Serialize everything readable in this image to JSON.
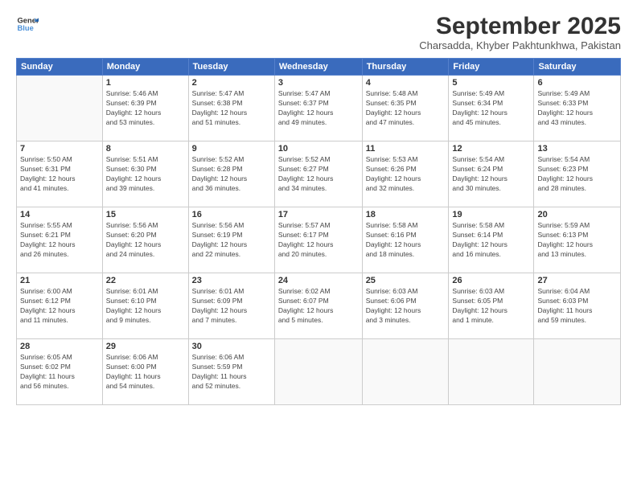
{
  "header": {
    "logo_line1": "General",
    "logo_line2": "Blue",
    "month": "September 2025",
    "location": "Charsadda, Khyber Pakhtunkhwa, Pakistan"
  },
  "weekdays": [
    "Sunday",
    "Monday",
    "Tuesday",
    "Wednesday",
    "Thursday",
    "Friday",
    "Saturday"
  ],
  "weeks": [
    [
      {
        "day": "",
        "detail": ""
      },
      {
        "day": "1",
        "detail": "Sunrise: 5:46 AM\nSunset: 6:39 PM\nDaylight: 12 hours\nand 53 minutes."
      },
      {
        "day": "2",
        "detail": "Sunrise: 5:47 AM\nSunset: 6:38 PM\nDaylight: 12 hours\nand 51 minutes."
      },
      {
        "day": "3",
        "detail": "Sunrise: 5:47 AM\nSunset: 6:37 PM\nDaylight: 12 hours\nand 49 minutes."
      },
      {
        "day": "4",
        "detail": "Sunrise: 5:48 AM\nSunset: 6:35 PM\nDaylight: 12 hours\nand 47 minutes."
      },
      {
        "day": "5",
        "detail": "Sunrise: 5:49 AM\nSunset: 6:34 PM\nDaylight: 12 hours\nand 45 minutes."
      },
      {
        "day": "6",
        "detail": "Sunrise: 5:49 AM\nSunset: 6:33 PM\nDaylight: 12 hours\nand 43 minutes."
      }
    ],
    [
      {
        "day": "7",
        "detail": "Sunrise: 5:50 AM\nSunset: 6:31 PM\nDaylight: 12 hours\nand 41 minutes."
      },
      {
        "day": "8",
        "detail": "Sunrise: 5:51 AM\nSunset: 6:30 PM\nDaylight: 12 hours\nand 39 minutes."
      },
      {
        "day": "9",
        "detail": "Sunrise: 5:52 AM\nSunset: 6:28 PM\nDaylight: 12 hours\nand 36 minutes."
      },
      {
        "day": "10",
        "detail": "Sunrise: 5:52 AM\nSunset: 6:27 PM\nDaylight: 12 hours\nand 34 minutes."
      },
      {
        "day": "11",
        "detail": "Sunrise: 5:53 AM\nSunset: 6:26 PM\nDaylight: 12 hours\nand 32 minutes."
      },
      {
        "day": "12",
        "detail": "Sunrise: 5:54 AM\nSunset: 6:24 PM\nDaylight: 12 hours\nand 30 minutes."
      },
      {
        "day": "13",
        "detail": "Sunrise: 5:54 AM\nSunset: 6:23 PM\nDaylight: 12 hours\nand 28 minutes."
      }
    ],
    [
      {
        "day": "14",
        "detail": "Sunrise: 5:55 AM\nSunset: 6:21 PM\nDaylight: 12 hours\nand 26 minutes."
      },
      {
        "day": "15",
        "detail": "Sunrise: 5:56 AM\nSunset: 6:20 PM\nDaylight: 12 hours\nand 24 minutes."
      },
      {
        "day": "16",
        "detail": "Sunrise: 5:56 AM\nSunset: 6:19 PM\nDaylight: 12 hours\nand 22 minutes."
      },
      {
        "day": "17",
        "detail": "Sunrise: 5:57 AM\nSunset: 6:17 PM\nDaylight: 12 hours\nand 20 minutes."
      },
      {
        "day": "18",
        "detail": "Sunrise: 5:58 AM\nSunset: 6:16 PM\nDaylight: 12 hours\nand 18 minutes."
      },
      {
        "day": "19",
        "detail": "Sunrise: 5:58 AM\nSunset: 6:14 PM\nDaylight: 12 hours\nand 16 minutes."
      },
      {
        "day": "20",
        "detail": "Sunrise: 5:59 AM\nSunset: 6:13 PM\nDaylight: 12 hours\nand 13 minutes."
      }
    ],
    [
      {
        "day": "21",
        "detail": "Sunrise: 6:00 AM\nSunset: 6:12 PM\nDaylight: 12 hours\nand 11 minutes."
      },
      {
        "day": "22",
        "detail": "Sunrise: 6:01 AM\nSunset: 6:10 PM\nDaylight: 12 hours\nand 9 minutes."
      },
      {
        "day": "23",
        "detail": "Sunrise: 6:01 AM\nSunset: 6:09 PM\nDaylight: 12 hours\nand 7 minutes."
      },
      {
        "day": "24",
        "detail": "Sunrise: 6:02 AM\nSunset: 6:07 PM\nDaylight: 12 hours\nand 5 minutes."
      },
      {
        "day": "25",
        "detail": "Sunrise: 6:03 AM\nSunset: 6:06 PM\nDaylight: 12 hours\nand 3 minutes."
      },
      {
        "day": "26",
        "detail": "Sunrise: 6:03 AM\nSunset: 6:05 PM\nDaylight: 12 hours\nand 1 minute."
      },
      {
        "day": "27",
        "detail": "Sunrise: 6:04 AM\nSunset: 6:03 PM\nDaylight: 11 hours\nand 59 minutes."
      }
    ],
    [
      {
        "day": "28",
        "detail": "Sunrise: 6:05 AM\nSunset: 6:02 PM\nDaylight: 11 hours\nand 56 minutes."
      },
      {
        "day": "29",
        "detail": "Sunrise: 6:06 AM\nSunset: 6:00 PM\nDaylight: 11 hours\nand 54 minutes."
      },
      {
        "day": "30",
        "detail": "Sunrise: 6:06 AM\nSunset: 5:59 PM\nDaylight: 11 hours\nand 52 minutes."
      },
      {
        "day": "",
        "detail": ""
      },
      {
        "day": "",
        "detail": ""
      },
      {
        "day": "",
        "detail": ""
      },
      {
        "day": "",
        "detail": ""
      }
    ]
  ]
}
